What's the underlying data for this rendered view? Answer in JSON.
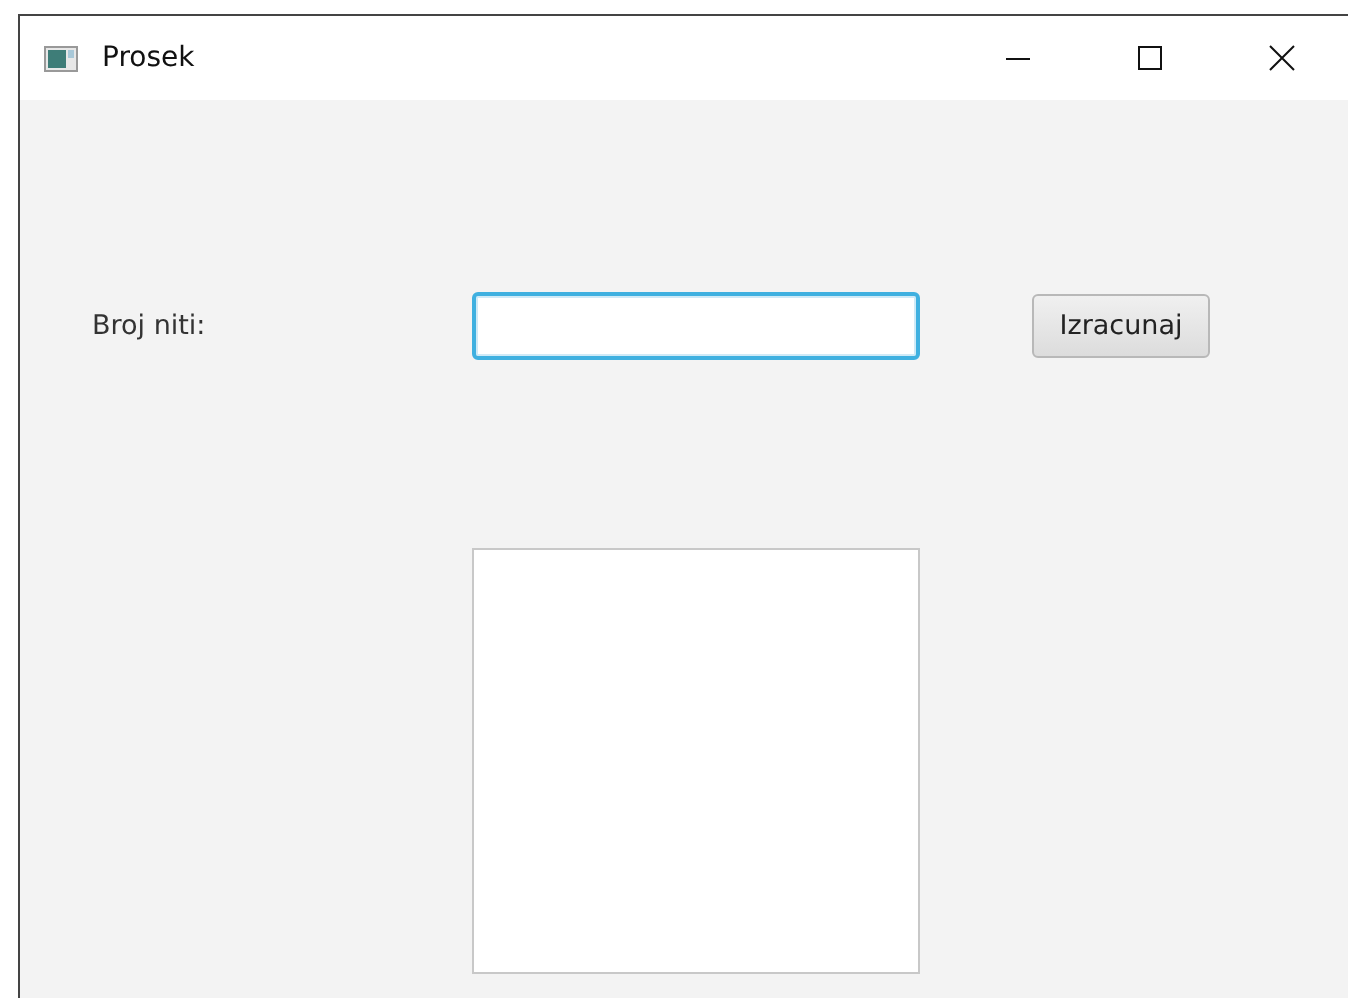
{
  "window": {
    "title": "Prosek"
  },
  "form": {
    "label": "Broj niti:",
    "input": {
      "focused": true
    },
    "button": "Izracunaj"
  },
  "output_area": {
    "kind": "text-area"
  }
}
